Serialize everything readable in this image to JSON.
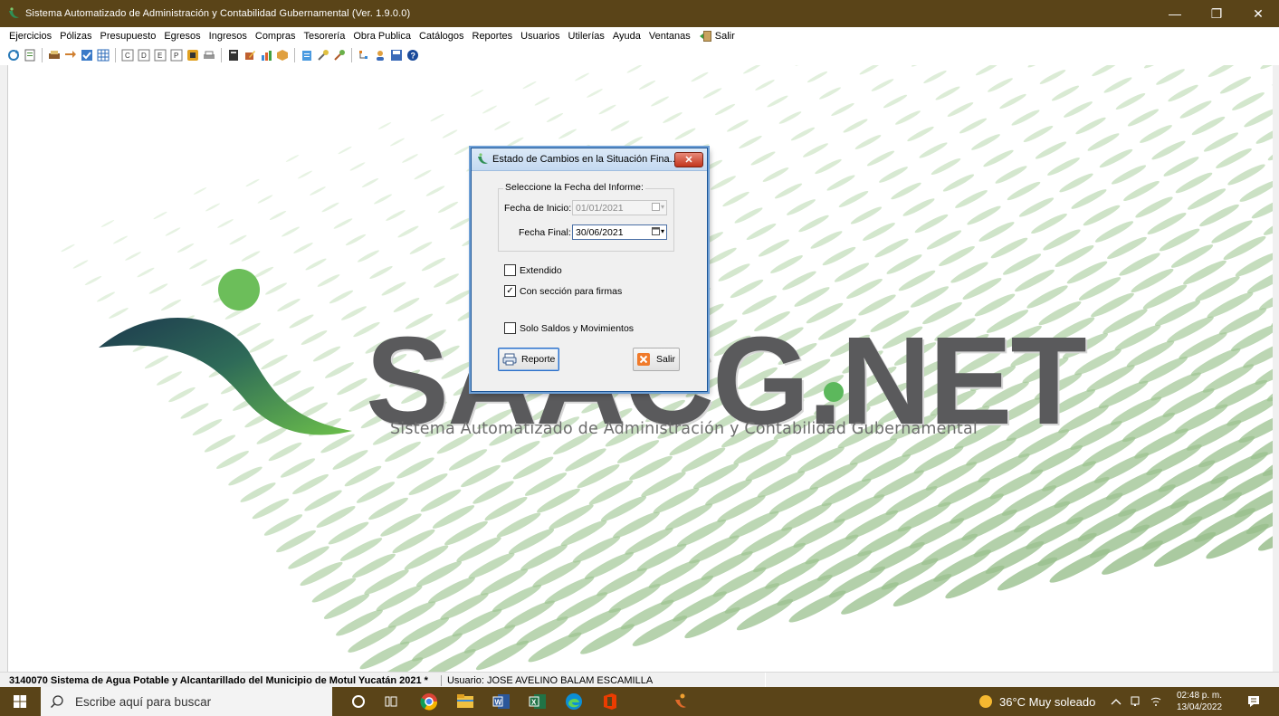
{
  "window": {
    "title": "Sistema Automatizado de Administración y Contabilidad Gubernamental  (Ver. 1.9.0.0)",
    "minimize_glyph": "—",
    "maximize_glyph": "❐",
    "close_glyph": "✕"
  },
  "menu": {
    "items": [
      "Ejercicios",
      "Pólizas",
      "Presupuesto",
      "Egresos",
      "Ingresos",
      "Compras",
      "Tesorería",
      "Obra Publica",
      "Catálogos",
      "Reportes",
      "Usuarios",
      "Utilerías",
      "Ayuda",
      "Ventanas"
    ],
    "exit_label": "Salir"
  },
  "brand": {
    "logo_text": "SAACG.NET",
    "subtitle": "Sistema Automatizado de Administración y Contabilidad Gubernamental"
  },
  "dialog": {
    "title": "Estado de Cambios en la Situación Fina...",
    "close_glyph": "✕",
    "group_label": "Seleccione la Fecha del Informe:",
    "start_label": "Fecha de Inicio:",
    "start_value": "01/01/2021",
    "end_label": "Fecha Final:",
    "end_value": "30/06/2021",
    "extendido_label": "Extendido",
    "extendido_checked": false,
    "firmas_label": "Con sección para firmas",
    "firmas_checked": true,
    "saldos_label": "Solo Saldos y Movimientos",
    "saldos_checked": false,
    "report_button": "Reporte",
    "exit_button": "Salir"
  },
  "status": {
    "organization": "3140070 Sistema de Agua Potable y Alcantarillado del Municipio de Motul Yucatán  2021  *",
    "user": "Usuario: JOSE AVELINO BALAM ESCAMILLA"
  },
  "taskbar": {
    "search_placeholder": "Escribe aquí para buscar",
    "weather": "36°C  Muy soleado",
    "time": "02:48 p. m.",
    "date": "13/04/2022"
  },
  "colors": {
    "titlebar": "#5a4418",
    "brand_gray": "#5a5a5c",
    "brand_green": "#5cb85c",
    "dialog_border": "#1c5596"
  }
}
